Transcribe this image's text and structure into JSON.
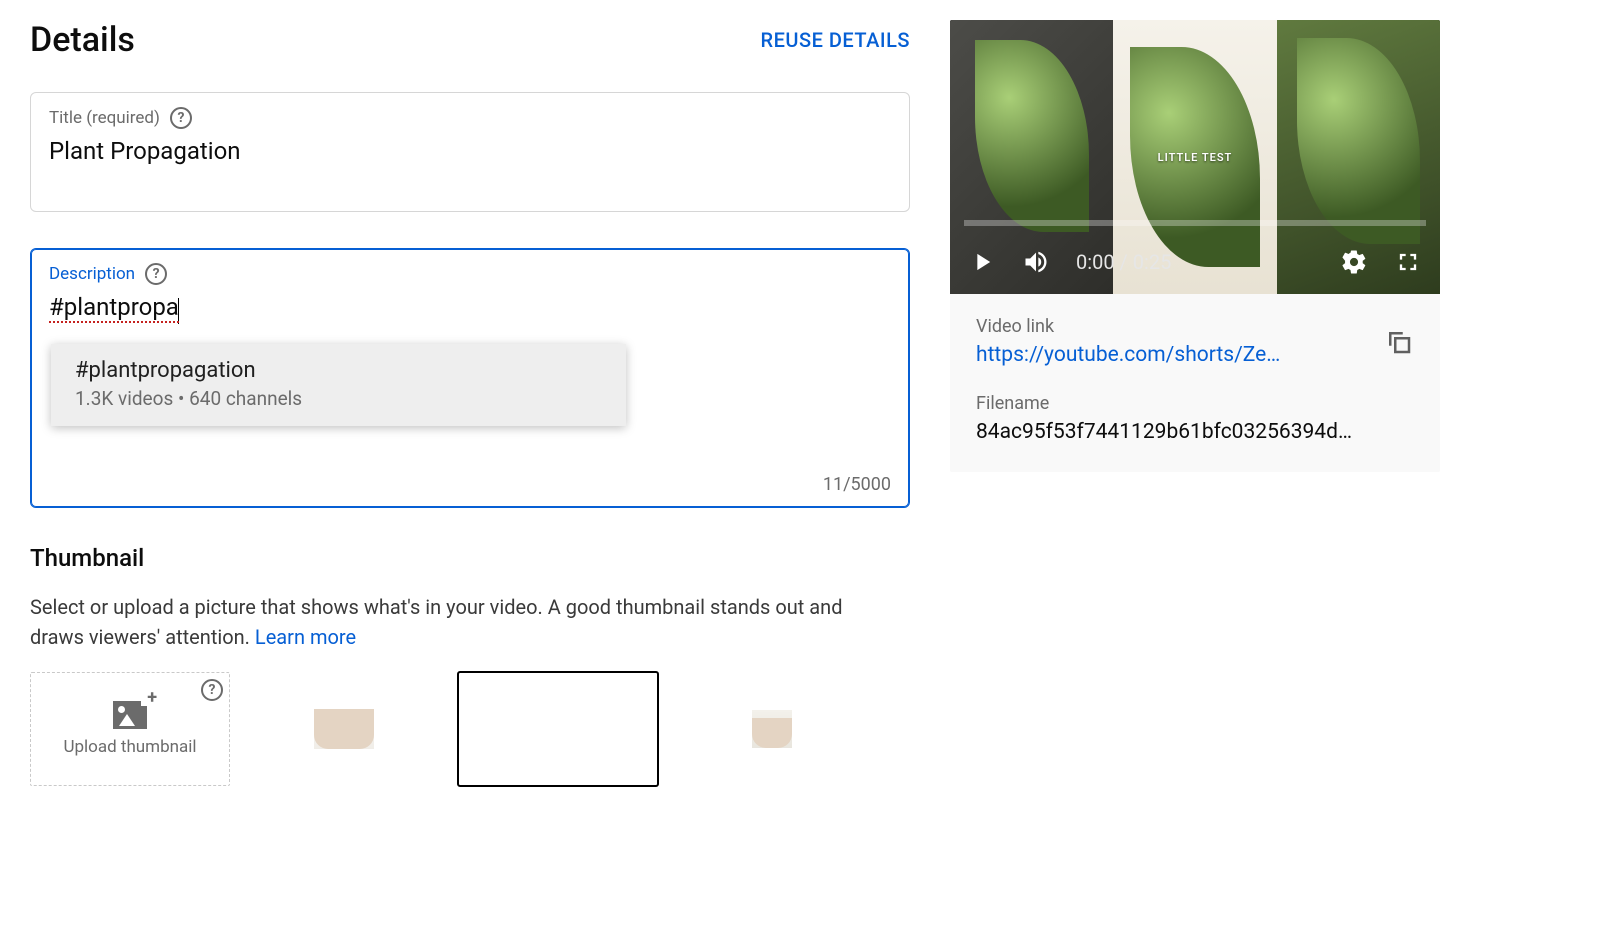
{
  "header": {
    "title": "Details",
    "reuse_label": "REUSE DETAILS"
  },
  "title_field": {
    "label": "Title (required)",
    "value": "Plant Propagation"
  },
  "description_field": {
    "label": "Description",
    "value": "#plantpropa",
    "counter": "11/5000"
  },
  "suggestion": {
    "tag": "#plantpropagation",
    "meta": "1.3K videos • 640 channels"
  },
  "thumbnail": {
    "heading": "Thumbnail",
    "description_prefix": "Select or upload a picture that shows what's in your video. A good thumbnail stands out and draws viewers' attention. ",
    "learn_more": "Learn more",
    "upload_label": "Upload thumbnail"
  },
  "video": {
    "overlay_text": "LITTLE TEST",
    "time_current": "0:00",
    "time_total": "0:25",
    "link_label": "Video link",
    "link_value": "https://youtube.com/shorts/Ze…",
    "filename_label": "Filename",
    "filename_value": "84ac95f53f7441129b61bfc03256394d…"
  }
}
